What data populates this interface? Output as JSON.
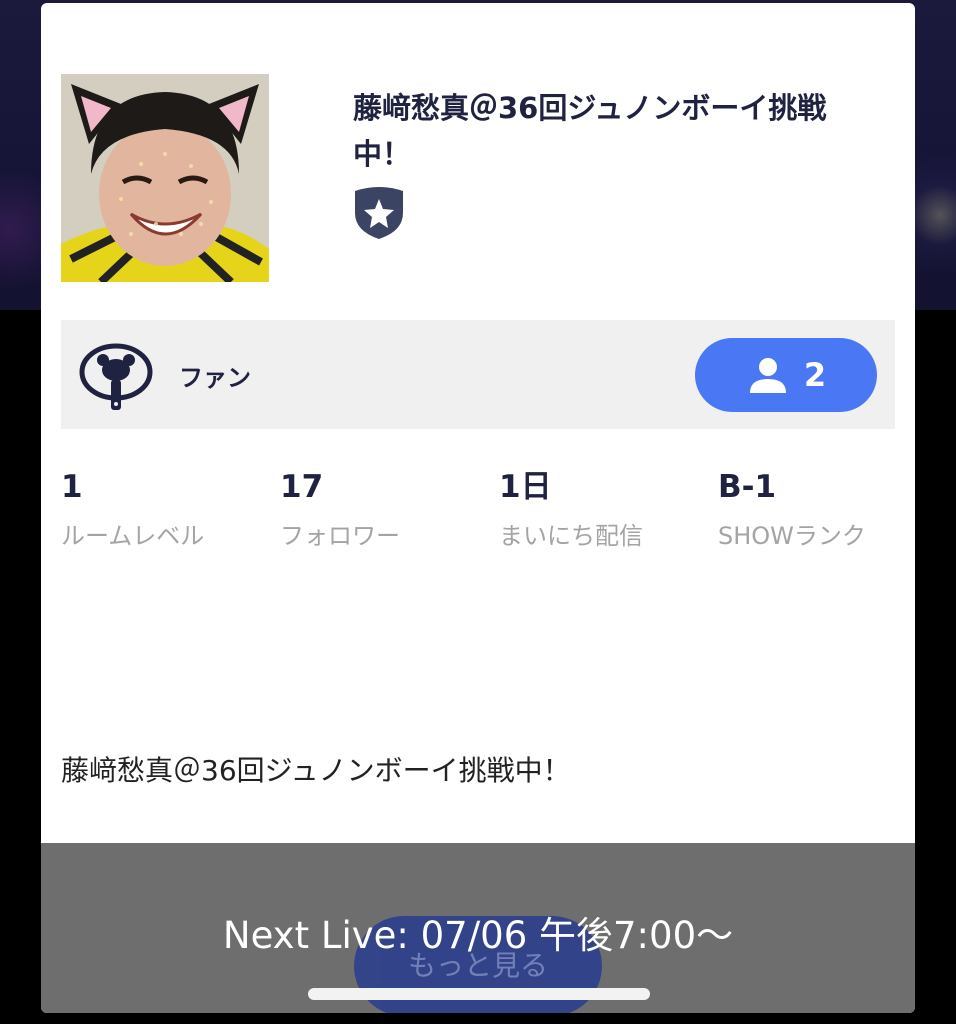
{
  "profile": {
    "room_title": "藤﨑愁真＠36回ジュノンボーイ挑戦中！",
    "badge_icon": "star-shield-icon"
  },
  "fan": {
    "icon": "fan-uchiwa-icon",
    "label": "ファン",
    "count_icon": "person-icon",
    "count": "2"
  },
  "stats": [
    {
      "value": "1",
      "label": "ルームレベル"
    },
    {
      "value": "17",
      "label": "フォロワー"
    },
    {
      "value": "1日",
      "label": "まいにち配信"
    },
    {
      "value": "B-1",
      "label": "SHOWランク"
    }
  ],
  "description": "藤﨑愁真＠36回ジュノンボーイ挑戦中！",
  "more_button": "もっと見る",
  "next_live": "Next Live: 07/06 午後7:00～",
  "colors": {
    "accent": "#4a78f5",
    "title_text": "#1f2240",
    "label_gray": "#a4a4a4",
    "overlay": "#6e6e6e"
  }
}
